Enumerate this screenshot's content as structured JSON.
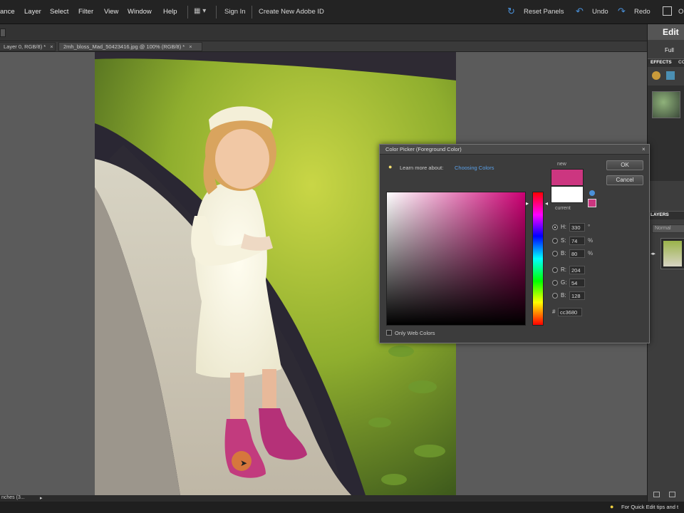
{
  "menubar": {
    "items": [
      "ance",
      "Layer",
      "Select",
      "Filter",
      "View",
      "Window",
      "Help"
    ],
    "sign_in": "Sign In",
    "create_id": "Create New Adobe ID",
    "reset_panels": "Reset Panels",
    "undo": "Undo",
    "redo": "Redo",
    "organizer": "O"
  },
  "tabs": [
    {
      "label": "Layer 0, RGB/8) *",
      "close": "×"
    },
    {
      "label": "2mh_bloss_Mad_50423416.jpg @ 100% (RGB/8) *",
      "close": "×"
    }
  ],
  "right_panel": {
    "mode": "Edit",
    "submode": "Full",
    "effects_tab": "EFFECTS",
    "effects_tab2": "CO",
    "layers_label": "LAYERS",
    "blend_mode": "Normal"
  },
  "doc_status": "nches (3...",
  "status_tip": "For Quick Edit tips and t",
  "dialog": {
    "title": "Color Picker (Foreground Color)",
    "learn_more": "Learn more about:",
    "learn_link": "Choosing Colors",
    "ok": "OK",
    "cancel": "Cancel",
    "new_label": "new",
    "current_label": "current",
    "new_color": "#cc3680",
    "current_color": "#ffffff",
    "fields": [
      {
        "label": "H:",
        "value": "330",
        "unit": "°",
        "selected": true
      },
      {
        "label": "S:",
        "value": "74",
        "unit": "%",
        "selected": false
      },
      {
        "label": "B:",
        "value": "80",
        "unit": "%",
        "selected": false
      },
      {
        "label": "R:",
        "value": "204",
        "unit": "",
        "selected": false
      },
      {
        "label": "G:",
        "value": "54",
        "unit": "",
        "selected": false
      },
      {
        "label": "B:",
        "value": "128",
        "unit": "",
        "selected": false
      }
    ],
    "hex_label": "#",
    "hex_value": "cc3680",
    "web_only": "Only Web Colors"
  }
}
